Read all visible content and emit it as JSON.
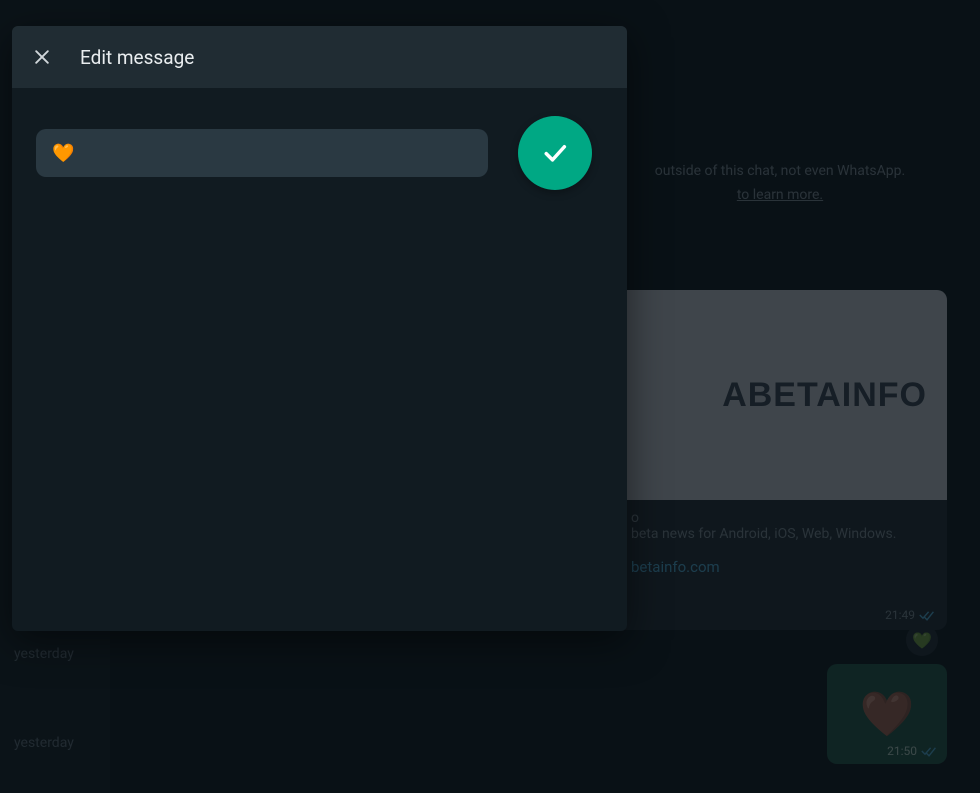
{
  "watermark": "WABETAINFO",
  "sidebar": {
    "yesterday_label": "yesterday"
  },
  "chat": {
    "encryption_line1": "outside of this chat, not even WhatsApp.",
    "encryption_learn": "to learn more.",
    "link_card": {
      "preview_brand": "ABETAINFO",
      "title_fragment": "o",
      "desc": "beta news for Android, iOS, Web, Windows.",
      "url": "betainfo.com",
      "time": "21:49"
    },
    "reaction_emoji": "💚",
    "msg2": {
      "emoji": "🤎",
      "time": "21:50"
    }
  },
  "modal": {
    "title": "Edit message",
    "input_value": "🧡"
  },
  "icons": {
    "close": "close-icon",
    "check": "check-icon",
    "double_check": "double-check-icon"
  },
  "colors": {
    "bg": "#0b141a",
    "panel": "#111b21",
    "header": "#202c33",
    "input": "#2a3942",
    "accent": "#00a884",
    "link": "#53bdeb"
  }
}
